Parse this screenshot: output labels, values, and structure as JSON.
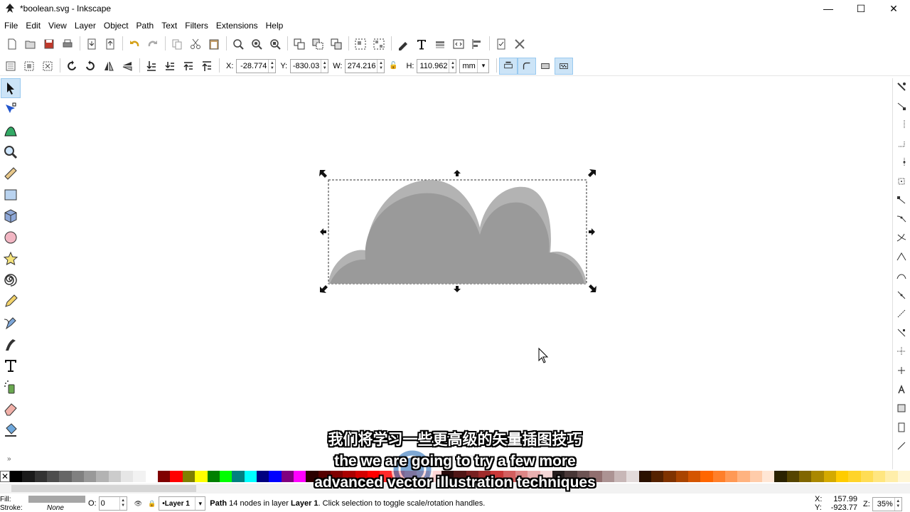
{
  "window": {
    "title": "*boolean.svg - Inkscape",
    "minimize_glyph": "—",
    "maximize_glyph": "☐",
    "close_glyph": "✕"
  },
  "menubar": {
    "items": [
      "File",
      "Edit",
      "View",
      "Layer",
      "Object",
      "Path",
      "Text",
      "Filters",
      "Extensions",
      "Help"
    ]
  },
  "toolbar": {
    "commands": [
      "new-document-icon",
      "open-icon",
      "save-icon",
      "print-icon",
      "import-icon",
      "export-icon",
      "undo-icon",
      "redo-icon",
      "copy-icon",
      "cut-icon",
      "paste-icon",
      "zoom-selection-icon",
      "zoom-drawing-icon",
      "zoom-page-icon",
      "duplicate-icon",
      "clone-icon",
      "unlink-clone-icon",
      "group-icon",
      "ungroup-icon",
      "fill-stroke-icon",
      "text-font-icon",
      "layers-icon",
      "xml-editor-icon",
      "align-distribute-icon",
      "document-properties-icon",
      "preferences-icon"
    ]
  },
  "tool_controls": {
    "x_label": "X:",
    "x_value": "-28.774",
    "y_label": "Y:",
    "y_value": "-830.03",
    "w_label": "W:",
    "w_value": "274.216",
    "h_label": "H:",
    "h_value": "110.962",
    "unit": "mm"
  },
  "tools": [
    "selector-icon",
    "node-editor-icon",
    "tweak-icon",
    "zoom-icon",
    "measure-icon",
    "rectangle-icon",
    "3d-box-icon",
    "ellipse-icon",
    "star-icon",
    "spiral-icon",
    "pencil-icon",
    "pen-icon",
    "calligraphy-icon",
    "text-icon",
    "spray-icon",
    "eraser-icon",
    "paint-bucket-icon"
  ],
  "toolbox_more": "»",
  "canvas": {
    "shape_fill": "#a6a6a6",
    "shape_top_fill": "#b3b3b3",
    "shape_inner_fill": "#9a9a9a"
  },
  "palette": {
    "no_color_glyph": "✕",
    "colors": [
      "#000000",
      "#1a1a1a",
      "#333333",
      "#4d4d4d",
      "#666666",
      "#808080",
      "#999999",
      "#b3b3b3",
      "#cccccc",
      "#e6e6e6",
      "#f2f2f2",
      "#ffffff",
      "#800000",
      "#ff0000",
      "#808000",
      "#ffff00",
      "#008000",
      "#00ff00",
      "#008080",
      "#00ffff",
      "#000080",
      "#0000ff",
      "#800080",
      "#ff00ff",
      "#2b0000",
      "#550000",
      "#800000",
      "#aa0000",
      "#d40000",
      "#ff0000",
      "#ff2a2a",
      "#ff5555",
      "#ff8080",
      "#ffaaaa",
      "#ffd5d5",
      "#280b0b",
      "#501616",
      "#782121",
      "#a02c2c",
      "#c83737",
      "#d35f5f",
      "#de8787",
      "#e9afaf",
      "#f4d7d7",
      "#241c1c",
      "#483737",
      "#6c5353",
      "#916f6f",
      "#ac9393",
      "#c8b7b7",
      "#e3dbdb",
      "#2b1100",
      "#552200",
      "#803300",
      "#aa4400",
      "#d45500",
      "#ff6600",
      "#ff7f2a",
      "#ff9955",
      "#ffb380",
      "#ffccaa",
      "#ffe6d5",
      "#2b2200",
      "#554400",
      "#806600",
      "#aa8800",
      "#d4aa00",
      "#ffcc00",
      "#ffd42a",
      "#ffdd55",
      "#ffe680",
      "#ffeeaa",
      "#fff6d5"
    ]
  },
  "statusbar": {
    "fill_label": "Fill:",
    "stroke_label": "Stroke:",
    "stroke_value": "None",
    "fill_color": "#a6a6a6",
    "opacity_label": "O:",
    "opacity_value": "0",
    "layer_name": "•Layer 1",
    "msg_object": "Path",
    "msg_mid": " 14 nodes in layer ",
    "msg_layer": "Layer 1",
    "msg_end": ". Click selection to toggle scale/rotation handles.",
    "x_label": "X:",
    "x_value": "157.99",
    "y_label": "Y:",
    "y_value": "-923.77",
    "zoom_label": "Z:",
    "zoom_value": "35%"
  },
  "subtitles": {
    "line1": "我们将学习一些更高级的矢量插图技巧",
    "line2": "the we are going to try a few more",
    "line3": "advanced vector illustration techniques",
    "watermark": "RRCG"
  }
}
